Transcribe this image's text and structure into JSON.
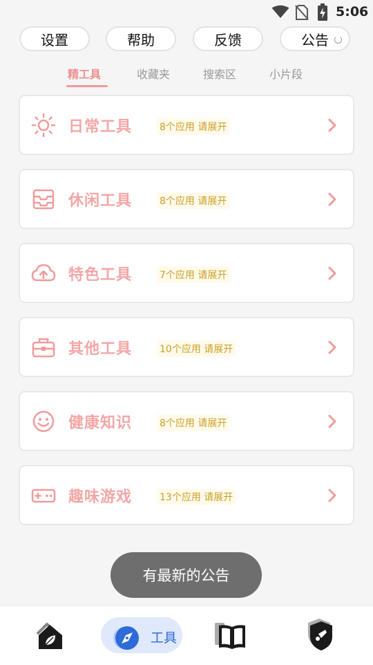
{
  "status_bar": {
    "time": "5:06",
    "icons": [
      "wifi-icon",
      "no-sim-icon",
      "battery-charging-icon"
    ]
  },
  "top_buttons": [
    {
      "label": "设置"
    },
    {
      "label": "帮助"
    },
    {
      "label": "反馈"
    },
    {
      "label": "公告"
    }
  ],
  "tabs": [
    {
      "label": "精工具",
      "active": true
    },
    {
      "label": "收藏夹",
      "active": false
    },
    {
      "label": "搜索区",
      "active": false
    },
    {
      "label": "小片段",
      "active": false
    }
  ],
  "categories": [
    {
      "title": "日常工具",
      "badge": "8个应用 请展开",
      "icon": "sun-icon"
    },
    {
      "title": "休闲工具",
      "badge": "8个应用 请展开",
      "icon": "inbox-tray-icon"
    },
    {
      "title": "特色工具",
      "badge": "7个应用 请展开",
      "icon": "cloud-upload-icon"
    },
    {
      "title": "其他工具",
      "badge": "10个应用 请展开",
      "icon": "toolbox-icon"
    },
    {
      "title": "健康知识",
      "badge": "8个应用 请展开",
      "icon": "smiley-icon"
    },
    {
      "title": "趣味游戏",
      "badge": "13个应用 请展开",
      "icon": "gamepad-icon"
    }
  ],
  "toast": {
    "text": "有最新的公告"
  },
  "bottom_nav": {
    "items": [
      {
        "icon": "home-leaf-icon"
      },
      {
        "icon": "compass-icon",
        "label": "工具",
        "active": true
      },
      {
        "icon": "book-icon"
      },
      {
        "icon": "shield-icon"
      }
    ]
  },
  "colors": {
    "accent_pink": "#f19a9a",
    "badge_text": "#caa02a",
    "active_nav": "#2f6ad9"
  }
}
